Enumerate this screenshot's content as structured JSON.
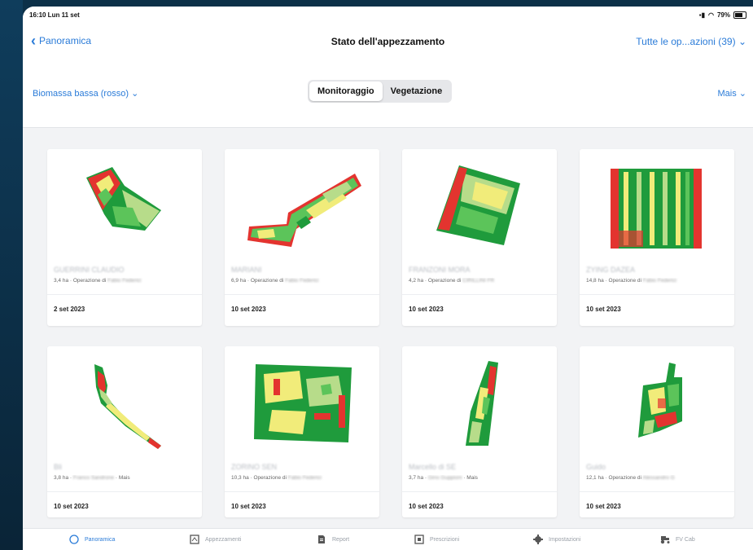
{
  "status": {
    "time": "16:10  Lun 11 set",
    "battery": "79%"
  },
  "nav": {
    "back_label": "Panoramica",
    "title": "Stato dell'appezzamento",
    "right_label": "Tutte le op...azioni (39)"
  },
  "filters": {
    "left": "Biomassa bassa (rosso)",
    "right": "Mais",
    "segments": [
      "Monitoraggio",
      "Vegetazione"
    ],
    "active_segment": "Monitoraggio"
  },
  "cards": [
    {
      "name": "GUERRINI CLAUDIO",
      "area": "3,4 ha",
      "info_tail": "Operazione di",
      "info_blur": "Fabio Federici",
      "date": "2 set 2023"
    },
    {
      "name": "MARIANI",
      "area": "6,9 ha",
      "info_tail": "Operazione di",
      "info_blur": "Fabio Federici",
      "date": "10 set 2023"
    },
    {
      "name": "FRANZONI MORA",
      "area": "4,2 ha",
      "info_tail": "Operazione di",
      "info_blur": "CIRILLINI FR",
      "date": "10 set 2023"
    },
    {
      "name": "ZYING DAZEA",
      "area": "14,8 ha",
      "info_tail": "Operazione di",
      "info_blur": "Fabio Federici",
      "date": "10 set 2023"
    },
    {
      "name": "Bli",
      "area": "3,8 ha",
      "info_tail": "Mais",
      "info_blur": "Franco Sandrone",
      "date": "10 set 2023"
    },
    {
      "name": "ZORINO SEN",
      "area": "10,3 ha",
      "info_tail": "Operazione di",
      "info_blur": "Fabio Federici",
      "date": "10 set 2023"
    },
    {
      "name": "Marcello di SE",
      "area": "3,7 ha",
      "info_tail": "Mais",
      "info_blur": "Gino Guppioni",
      "date": "10 set 2023"
    },
    {
      "name": "Guido",
      "area": "12,1 ha",
      "info_tail": "Operazione di",
      "info_blur": "Alessandro G",
      "date": "10 set 2023"
    }
  ],
  "tabs": [
    {
      "label": "Panoramica",
      "icon": "clock-icon",
      "active": true
    },
    {
      "label": "Appezzamenti",
      "icon": "field-icon"
    },
    {
      "label": "Report",
      "icon": "document-icon"
    },
    {
      "label": "Prescrizioni",
      "icon": "prescription-icon"
    },
    {
      "label": "Impostazioni",
      "icon": "gear-icon"
    },
    {
      "label": "FV Cab",
      "icon": "tractor-icon"
    }
  ],
  "colors": {
    "accent": "#2a7bd8",
    "dark_green": "#1f9b3c",
    "green": "#5cc45a",
    "light_green": "#b7dc8a",
    "yellow": "#f1ec7a",
    "red": "#e3342f"
  }
}
